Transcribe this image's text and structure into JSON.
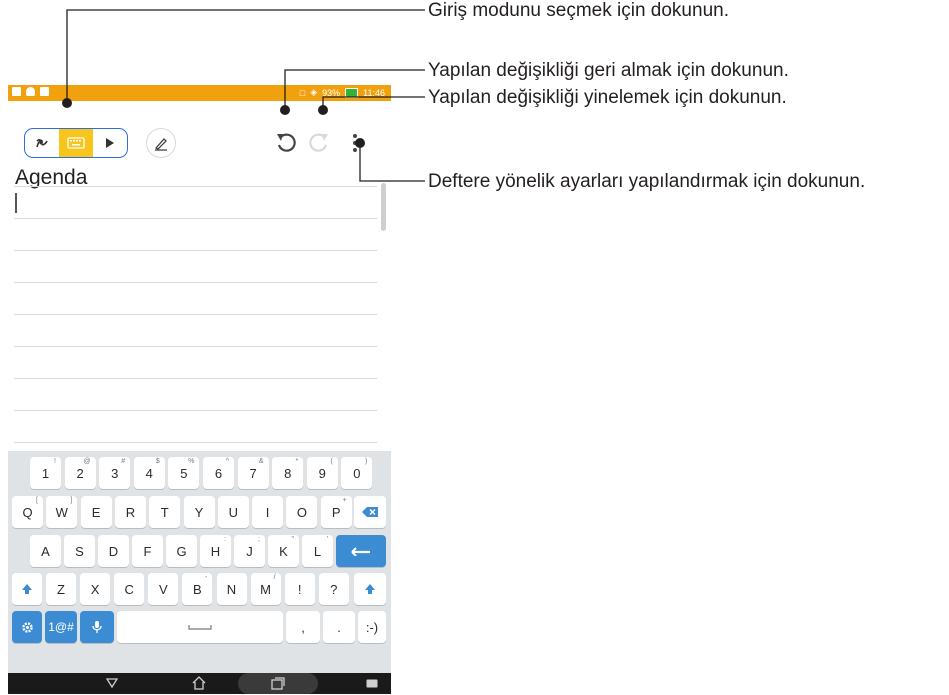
{
  "callouts": {
    "input_mode": "Giriş modunu seçmek için dokunun.",
    "undo": "Yapılan değişikliği geri almak için dokunun.",
    "redo": "Yapılan değişikliği yinelemek için dokunun.",
    "settings": "Deftere yönelik ayarları yapılandırmak için dokunun."
  },
  "status_bar": {
    "battery": "93%",
    "time": "11:46"
  },
  "note": {
    "title": "Agenda"
  },
  "keyboard": {
    "number_row": [
      {
        "label": "1",
        "sup": "!"
      },
      {
        "label": "2",
        "sup": "@"
      },
      {
        "label": "3",
        "sup": "#"
      },
      {
        "label": "4",
        "sup": "$"
      },
      {
        "label": "5",
        "sup": "%"
      },
      {
        "label": "6",
        "sup": "^"
      },
      {
        "label": "7",
        "sup": "&"
      },
      {
        "label": "8",
        "sup": "*"
      },
      {
        "label": "9",
        "sup": "("
      },
      {
        "label": "0",
        "sup": ")"
      }
    ],
    "row_q": [
      {
        "label": "Q",
        "sup": "["
      },
      {
        "label": "W",
        "sup": "]"
      },
      {
        "label": "E",
        "sup": ""
      },
      {
        "label": "R",
        "sup": ""
      },
      {
        "label": "T",
        "sup": ""
      },
      {
        "label": "Y",
        "sup": ""
      },
      {
        "label": "U",
        "sup": ""
      },
      {
        "label": "I",
        "sup": ""
      },
      {
        "label": "O",
        "sup": ""
      },
      {
        "label": "P",
        "sup": "+"
      }
    ],
    "row_a": [
      {
        "label": "A",
        "sup": ""
      },
      {
        "label": "S",
        "sup": ""
      },
      {
        "label": "D",
        "sup": ""
      },
      {
        "label": "F",
        "sup": ""
      },
      {
        "label": "G",
        "sup": ""
      },
      {
        "label": "H",
        "sup": ":"
      },
      {
        "label": "J",
        "sup": ";"
      },
      {
        "label": "K",
        "sup": "\""
      },
      {
        "label": "L",
        "sup": "'"
      }
    ],
    "row_z": [
      {
        "label": "Z",
        "sup": ""
      },
      {
        "label": "X",
        "sup": ""
      },
      {
        "label": "C",
        "sup": ""
      },
      {
        "label": "V",
        "sup": ""
      },
      {
        "label": "B",
        "sup": "-"
      },
      {
        "label": "N",
        "sup": ""
      },
      {
        "label": "M",
        "sup": "/"
      },
      {
        "label": "!",
        "sup": ""
      },
      {
        "label": "?",
        "sup": ""
      }
    ],
    "symbols_key": "1@#",
    "comma_key": ",",
    "period_key": ".",
    "smiley_key": ":-)"
  },
  "colors": {
    "status_bar": "#f1a10d",
    "mode_active": "#f7c51c",
    "mode_border": "#2b6fd9",
    "keyboard_bg": "#dfe3e6",
    "key_blue": "#3b8cd3"
  },
  "icons": {
    "mode_handwriting": "handwriting-icon",
    "mode_keyboard": "keyboard-icon",
    "mode_brush": "brush-icon",
    "pen_style": "pen-style-icon",
    "undo": "undo-icon",
    "redo": "redo-icon",
    "more": "more-vert-icon",
    "backspace": "backspace-icon",
    "enter": "enter-icon",
    "shift": "shift-icon",
    "settings": "gear-icon",
    "mic": "mic-icon",
    "space": "space-icon"
  }
}
